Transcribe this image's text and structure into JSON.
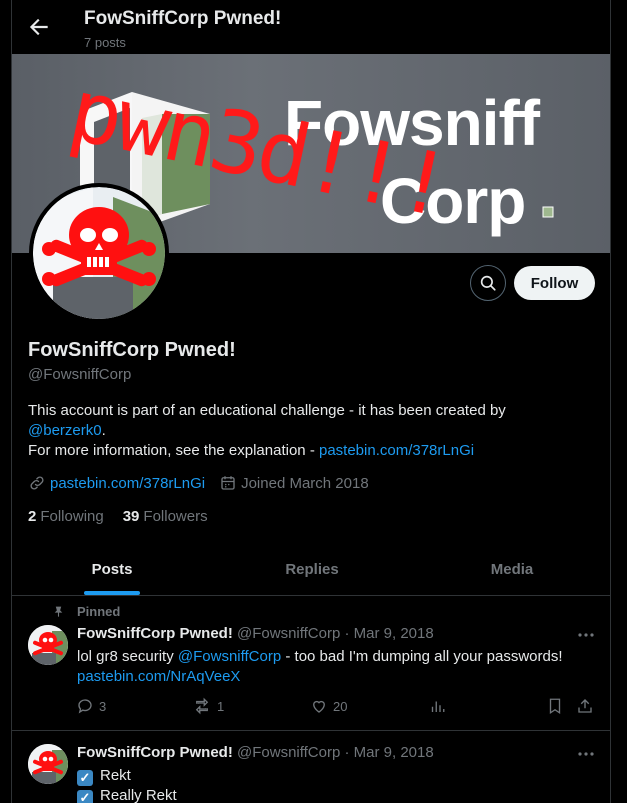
{
  "header": {
    "title": "FowSniffCorp Pwned!",
    "posts_count": "7 posts"
  },
  "banner": {
    "brand_line1": "Fowsniff",
    "brand_line2": "Corp",
    "graffiti": "pwn3d!!!",
    "graffiti_color": "#ff1a1a"
  },
  "profile": {
    "name": "FowSniffCorp Pwned!",
    "handle": "@FowsniffCorp",
    "bio_line1": "This account is part of an educational challenge - it has been created by",
    "bio_mention": "@berzerk0",
    "bio_after_mention": ".",
    "bio_line2": "For more information, see the explanation - ",
    "bio_link": "pastebin.com/378rLnGi",
    "website": "pastebin.com/378rLnGi",
    "joined": "Joined March 2018",
    "following_count": "2",
    "following_label": "Following",
    "followers_count": "39",
    "followers_label": "Followers",
    "follow_button": "Follow"
  },
  "tabs": [
    {
      "label": "Posts",
      "active": true
    },
    {
      "label": "Replies",
      "active": false
    },
    {
      "label": "Media",
      "active": false
    }
  ],
  "tweets": [
    {
      "pinned_label": "Pinned",
      "name": "FowSniffCorp Pwned!",
      "handle": "@FowsniffCorp",
      "date": " · Mar 9, 2018",
      "text_before": "lol gr8 security ",
      "mention": "@FowsniffCorp",
      "text_after": " - too bad I'm dumping all your passwords!",
      "link": "pastebin.com/NrAqVeeX",
      "replies": "3",
      "retweets": "1",
      "likes": "20"
    },
    {
      "name": "FowSniffCorp Pwned!",
      "handle": "@FowsniffCorp",
      "date": " · Mar 9, 2018",
      "line1": "Rekt",
      "line2": "Really Rekt"
    }
  ],
  "colors": {
    "accent": "#1d9bf0",
    "background": "#000000",
    "text": "#e7e9ea",
    "muted": "#71767b",
    "border": "#2f3336"
  }
}
